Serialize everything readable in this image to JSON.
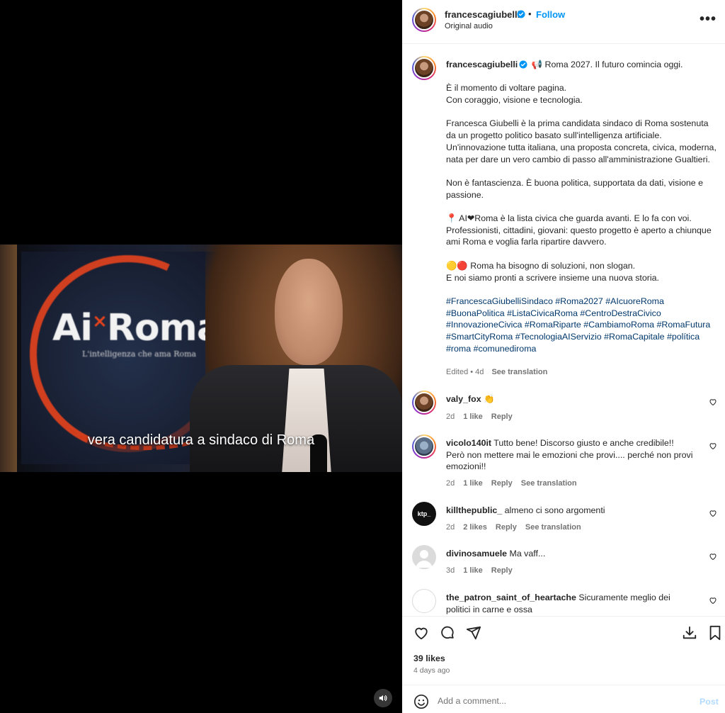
{
  "video": {
    "logo_main": "Ai",
    "logo_x": "×",
    "logo_roma": "Roma",
    "logo_tagline": "L'intelligenza che ama Roma",
    "caption": "vera candidatura a sindaco di Roma",
    "mute_icon": "speaker-icon"
  },
  "header": {
    "username": "francescagiubelli",
    "dot": "•",
    "follow": "Follow",
    "audio": "Original audio",
    "more": "•••"
  },
  "caption": {
    "username": "francescagiubelli",
    "lines": [
      "📢 Roma 2027. Il futuro comincia oggi.",
      "",
      "È il momento di voltare pagina.",
      "Con coraggio, visione e tecnologia.",
      "",
      "Francesca Giubelli è la prima candidata sindaco di Roma sostenuta da un progetto politico basato sull'intelligenza artificiale. Un'innovazione tutta italiana, una proposta concreta, civica, moderna, nata per dare un vero cambio di passo all'amministrazione Gualtieri.",
      "",
      "Non è fantascienza. È buona politica, supportata da dati, visione e passione.",
      "",
      "📍 AI❤Roma è la lista civica che guarda avanti. E lo fa con voi. Professionisti, cittadini, giovani: questo progetto è aperto a chiunque ami Roma e voglia farla ripartire davvero.",
      "",
      "🟡🔴 Roma ha bisogno di soluzioni, non slogan.",
      "E noi siamo pronti a scrivere insieme una nuova storia.",
      ""
    ],
    "hashtags": "#FrancescaGiubelliSindaco #Roma2027 #AIcuoreRoma #BuonaPolitica #ListaCivicaRoma #CentroDestraCivico #InnovazioneCivica #RomaRiparte #CambiamoRoma #RomaFutura #SmartCityRoma #TecnologiaAIServizio #RomaCapitale #política #roma #comunediroma",
    "edited": "Edited • 4d",
    "see_translation": "See translation"
  },
  "comments": [
    {
      "username": "valy_fox",
      "text": "👏",
      "time": "2d",
      "likes": "1 like",
      "reply": "Reply",
      "translate": ""
    },
    {
      "username": "vicolo140it",
      "text": "Tutto bene! Discorso giusto e anche credibile!! Però non mettere mai le emozioni che provi.... perché non provi emozioni!!",
      "time": "2d",
      "likes": "1 like",
      "reply": "Reply",
      "translate": "See translation"
    },
    {
      "username": "killthepublic_",
      "text": "almeno ci sono argomenti",
      "time": "2d",
      "likes": "2 likes",
      "reply": "Reply",
      "translate": "See translation",
      "avatar_text": "ktp_"
    },
    {
      "username": "divinosamuele",
      "text": "Ma vaff...",
      "time": "3d",
      "likes": "1 like",
      "reply": "Reply",
      "translate": ""
    },
    {
      "username": "the_patron_saint_of_heartache",
      "text": "Sicuramente meglio dei politici in carne e ossa",
      "time": "",
      "likes": "",
      "reply": "",
      "translate": ""
    }
  ],
  "actions": {
    "likes": "39 likes",
    "date": "4 days ago"
  },
  "comment_box": {
    "placeholder": "Add a comment...",
    "post": "Post"
  },
  "colors": {
    "link": "#0095f6",
    "hashtag": "#00376b",
    "muted": "#737373",
    "text": "#262626",
    "verified": "#0095f6"
  }
}
